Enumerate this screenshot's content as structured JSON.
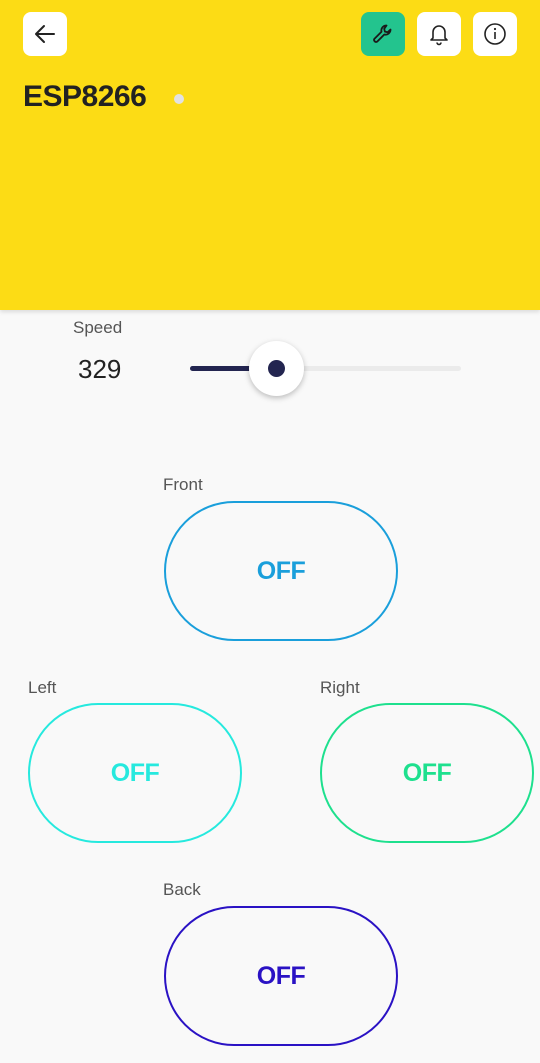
{
  "header": {
    "title": "ESP8266",
    "background": "#fcdc15",
    "buttons": {
      "back": "back-arrow-icon",
      "settings": "wrench-icon",
      "notifications": "bell-icon",
      "info": "info-icon"
    },
    "settings_active_color": "#23c48e",
    "status_color": "#e2e2e2"
  },
  "speed": {
    "label": "Speed",
    "value": "329",
    "level_fraction": 0.32,
    "color": "#232550"
  },
  "buttons": {
    "front": {
      "label": "Front",
      "state": "OFF",
      "color": "#1a9fdb"
    },
    "left": {
      "label": "Left",
      "state": "OFF",
      "color": "#26e9de"
    },
    "right": {
      "label": "Right",
      "state": "OFF",
      "color": "#1ee08e"
    },
    "back": {
      "label": "Back",
      "state": "OFF",
      "color": "#2a12c4"
    }
  }
}
